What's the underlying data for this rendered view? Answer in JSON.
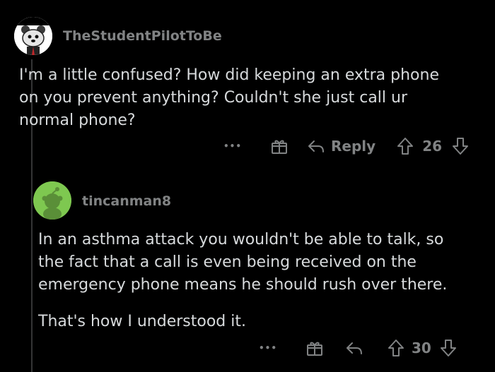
{
  "comments": [
    {
      "username": "TheStudentPilotToBe",
      "avatar": "snoo-dog-avatar",
      "paragraphs": [
        "I'm a little confused? How did keeping an extra phone",
        "on you prevent anything? Couldn't she just call ur",
        "normal phone?"
      ],
      "actions": {
        "more": "•••",
        "reply": "Reply",
        "score": "26"
      }
    },
    {
      "username": "tincanman8",
      "avatar": "green-snoo-avatar",
      "paragraphs": [
        "In an asthma attack you wouldn't be able to talk, so",
        "the fact that a call is even being received on the",
        "emergency phone means he should rush over there.",
        "That's how I understood it."
      ],
      "actions": {
        "more": "•••",
        "score": "30"
      }
    }
  ],
  "colors": {
    "background": "#000000",
    "text": "#d7dadc",
    "muted": "#818384",
    "thread_line": "#343536",
    "avatar_green": "#7ec850"
  }
}
